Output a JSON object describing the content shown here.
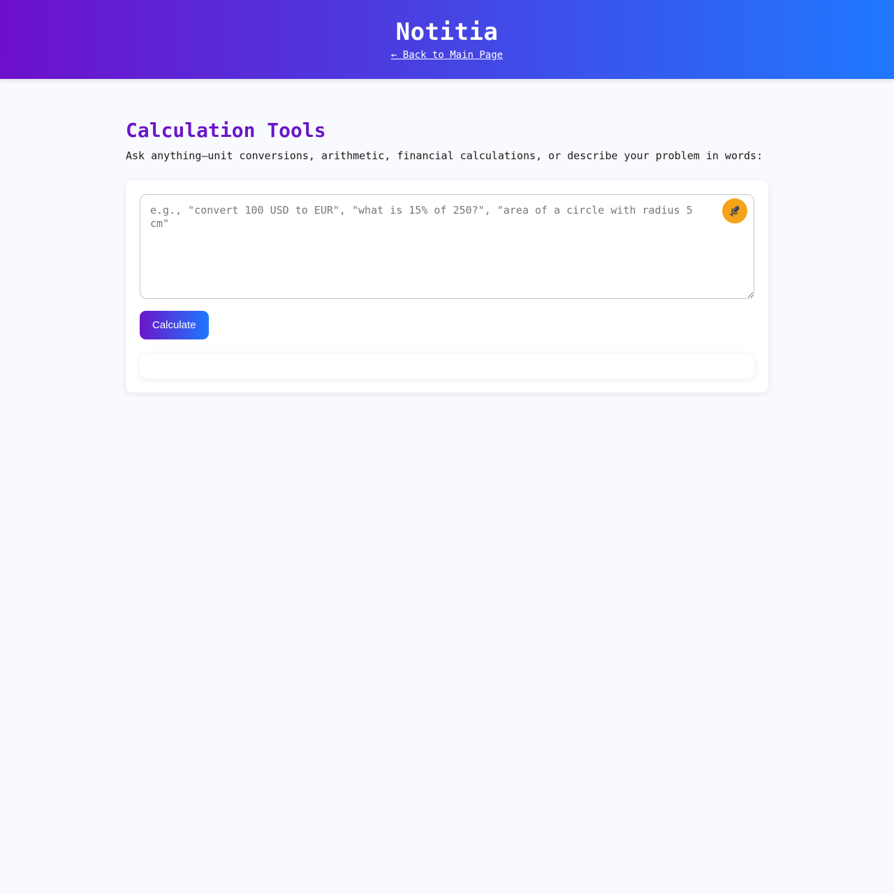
{
  "header": {
    "brand": "Notitia",
    "back_link": "← Back to Main Page",
    "gradient_start": "#6d10cc",
    "gradient_end": "#1f78ff"
  },
  "main": {
    "title": "Calculation Tools",
    "description": "Ask anything—unit conversions, arithmetic, financial calculations, or describe your problem in words:",
    "title_color": "#6a16c8"
  },
  "calculator": {
    "input_value": "",
    "input_placeholder": "e.g., \"convert 100 USD to EUR\", \"what is 15% of 250?\", \"area of a circle with radius 5 cm\"",
    "mic_icon": "microphone-icon",
    "mic_color": "#f5a31a",
    "calculate_label": "Calculate",
    "result": ""
  }
}
